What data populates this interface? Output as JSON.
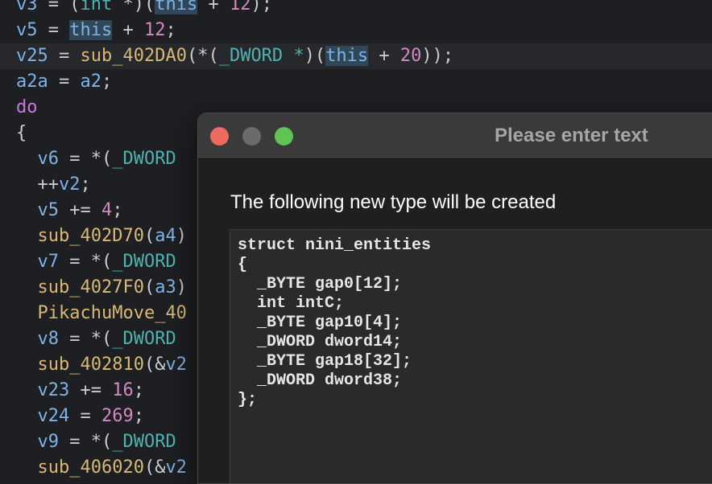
{
  "editor": {
    "lines": [
      [
        {
          "c": "t-var",
          "t": "v3"
        },
        {
          "c": "t-op",
          "t": " = "
        },
        {
          "c": "t-op",
          "t": "("
        },
        {
          "c": "t-type",
          "t": "int"
        },
        {
          "c": "t-op",
          "t": " *)("
        },
        {
          "c": "t-this",
          "t": "this"
        },
        {
          "c": "t-op",
          "t": " + "
        },
        {
          "c": "t-num",
          "t": "12"
        },
        {
          "c": "t-op",
          "t": ");"
        }
      ],
      [
        {
          "c": "t-var",
          "t": "v5"
        },
        {
          "c": "t-op",
          "t": " = "
        },
        {
          "c": "t-this",
          "t": "this"
        },
        {
          "c": "t-op",
          "t": " + "
        },
        {
          "c": "t-num",
          "t": "12"
        },
        {
          "c": "t-op",
          "t": ";"
        }
      ],
      [
        {
          "c": "t-var",
          "t": "v25"
        },
        {
          "c": "t-op",
          "t": " = "
        },
        {
          "c": "t-fn",
          "t": "sub_402DA0"
        },
        {
          "c": "t-op",
          "t": "(*("
        },
        {
          "c": "t-type",
          "t": "_DWORD"
        },
        {
          "c": "t-op",
          "t": " "
        },
        {
          "c": "t-type",
          "t": "*"
        },
        {
          "c": "t-op",
          "t": ")("
        },
        {
          "c": "t-this",
          "t": "this"
        },
        {
          "c": "t-op",
          "t": " + "
        },
        {
          "c": "t-num",
          "t": "20"
        },
        {
          "c": "t-op",
          "t": "));"
        }
      ],
      [
        {
          "c": "t-var",
          "t": "a2a"
        },
        {
          "c": "t-op",
          "t": " = "
        },
        {
          "c": "t-var",
          "t": "a2"
        },
        {
          "c": "t-op",
          "t": ";"
        }
      ],
      [
        {
          "c": "t-kw",
          "t": "do"
        }
      ],
      [
        {
          "c": "t-op",
          "t": "{"
        }
      ],
      [
        {
          "c": "t-plain",
          "t": "  "
        },
        {
          "c": "t-var",
          "t": "v6"
        },
        {
          "c": "t-op",
          "t": " = *("
        },
        {
          "c": "t-type",
          "t": "_DWORD"
        }
      ],
      [
        {
          "c": "t-plain",
          "t": "  "
        },
        {
          "c": "t-op",
          "t": "++"
        },
        {
          "c": "t-var",
          "t": "v2"
        },
        {
          "c": "t-op",
          "t": ";"
        }
      ],
      [
        {
          "c": "t-plain",
          "t": "  "
        },
        {
          "c": "t-var",
          "t": "v5"
        },
        {
          "c": "t-op",
          "t": " += "
        },
        {
          "c": "t-num",
          "t": "4"
        },
        {
          "c": "t-op",
          "t": ";"
        }
      ],
      [
        {
          "c": "t-plain",
          "t": "  "
        },
        {
          "c": "t-fn",
          "t": "sub_402D70"
        },
        {
          "c": "t-op",
          "t": "("
        },
        {
          "c": "t-var",
          "t": "a4"
        },
        {
          "c": "t-op",
          "t": ")"
        }
      ],
      [
        {
          "c": "t-plain",
          "t": "  "
        },
        {
          "c": "t-var",
          "t": "v7"
        },
        {
          "c": "t-op",
          "t": " = *("
        },
        {
          "c": "t-type",
          "t": "_DWORD"
        }
      ],
      [
        {
          "c": "t-plain",
          "t": "  "
        },
        {
          "c": "t-fn",
          "t": "sub_4027F0"
        },
        {
          "c": "t-op",
          "t": "("
        },
        {
          "c": "t-var",
          "t": "a3"
        },
        {
          "c": "t-op",
          "t": ")"
        }
      ],
      [
        {
          "c": "t-plain",
          "t": "  "
        },
        {
          "c": "t-fn",
          "t": "PikachuMove_40"
        }
      ],
      [
        {
          "c": "t-plain",
          "t": "  "
        },
        {
          "c": "t-var",
          "t": "v8"
        },
        {
          "c": "t-op",
          "t": " = *("
        },
        {
          "c": "t-type",
          "t": "_DWORD"
        }
      ],
      [
        {
          "c": "t-plain",
          "t": "  "
        },
        {
          "c": "t-fn",
          "t": "sub_402810"
        },
        {
          "c": "t-op",
          "t": "(&"
        },
        {
          "c": "t-var",
          "t": "v2"
        }
      ],
      [
        {
          "c": "t-plain",
          "t": "  "
        },
        {
          "c": "t-var",
          "t": "v23"
        },
        {
          "c": "t-op",
          "t": " += "
        },
        {
          "c": "t-num",
          "t": "16"
        },
        {
          "c": "t-op",
          "t": ";"
        }
      ],
      [
        {
          "c": "t-plain",
          "t": "  "
        },
        {
          "c": "t-var",
          "t": "v24"
        },
        {
          "c": "t-op",
          "t": " = "
        },
        {
          "c": "t-num",
          "t": "269"
        },
        {
          "c": "t-op",
          "t": ";"
        }
      ],
      [
        {
          "c": "t-plain",
          "t": "  "
        },
        {
          "c": "t-var",
          "t": "v9"
        },
        {
          "c": "t-op",
          "t": " = *("
        },
        {
          "c": "t-type",
          "t": "_DWORD"
        }
      ],
      [
        {
          "c": "t-plain",
          "t": "  "
        },
        {
          "c": "t-fn",
          "t": "sub_406020"
        },
        {
          "c": "t-op",
          "t": "(&"
        },
        {
          "c": "t-var",
          "t": "v2"
        }
      ]
    ],
    "highlighted_line": 2
  },
  "dialog": {
    "title": "Please enter text",
    "message": "The following new type will be created",
    "struct_definition": "struct nini_entities\n{\n  _BYTE gap0[12];\n  int intC;\n  _BYTE gap10[4];\n  _DWORD dword14;\n  _BYTE gap18[32];\n  _DWORD dword38;\n};"
  }
}
